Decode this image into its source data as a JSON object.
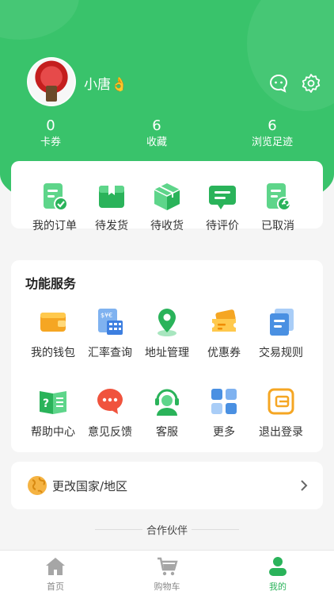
{
  "colors": {
    "primary": "#39c36b",
    "accent": "#2ab35a"
  },
  "profile": {
    "username": "小唐👌"
  },
  "stats": [
    {
      "value": "0",
      "label": "卡券"
    },
    {
      "value": "6",
      "label": "收藏"
    },
    {
      "value": "6",
      "label": "浏览足迹"
    }
  ],
  "orders": [
    {
      "label": "我的订单",
      "icon": "order-check-icon"
    },
    {
      "label": "待发货",
      "icon": "package-box-icon"
    },
    {
      "label": "待收货",
      "icon": "delivery-box-icon"
    },
    {
      "label": "待评价",
      "icon": "comment-icon"
    },
    {
      "label": "已取消",
      "icon": "cancel-doc-icon"
    }
  ],
  "services": {
    "title": "功能服务",
    "items": [
      {
        "label": "我的钱包",
        "icon": "wallet-icon"
      },
      {
        "label": "汇率查询",
        "icon": "calculator-icon"
      },
      {
        "label": "地址管理",
        "icon": "location-pin-icon"
      },
      {
        "label": "优惠券",
        "icon": "coupon-icon"
      },
      {
        "label": "交易规则",
        "icon": "document-stack-icon"
      },
      {
        "label": "帮助中心",
        "icon": "help-book-icon"
      },
      {
        "label": "意见反馈",
        "icon": "feedback-bubble-icon"
      },
      {
        "label": "客服",
        "icon": "customer-service-icon"
      },
      {
        "label": "更多",
        "icon": "grid-more-icon"
      },
      {
        "label": "退出登录",
        "icon": "logout-icon"
      }
    ]
  },
  "region": {
    "label": "更改国家/地区"
  },
  "partners": {
    "label": "合作伙伴"
  },
  "tabbar": [
    {
      "label": "首页",
      "icon": "home-icon",
      "active": false
    },
    {
      "label": "购物车",
      "icon": "cart-icon",
      "active": false
    },
    {
      "label": "我的",
      "icon": "user-icon",
      "active": true
    }
  ]
}
